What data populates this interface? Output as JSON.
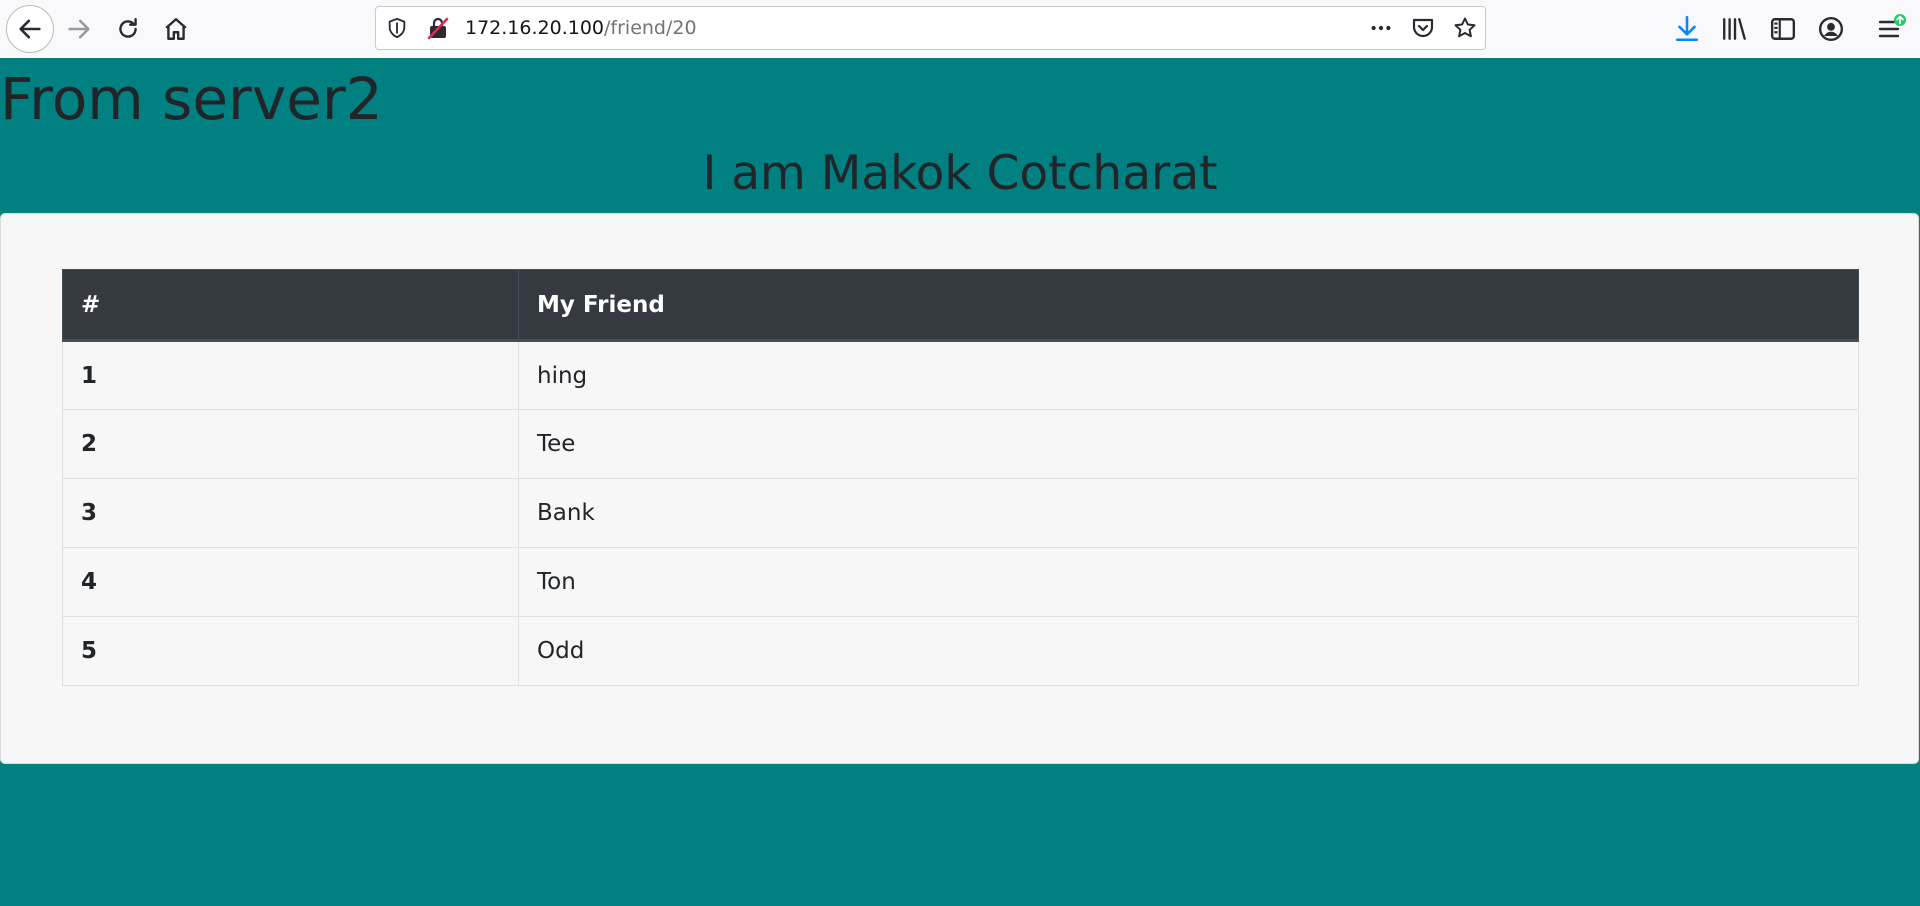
{
  "browser": {
    "url_host": "172.16.20.100",
    "url_path": "/friend/20",
    "icons": {
      "back": "back-arrow-icon",
      "forward": "forward-arrow-icon",
      "reload": "reload-icon",
      "home": "home-icon",
      "tracking": "shield-icon",
      "connection": "insecure-lock-icon",
      "page_actions": "more-icon",
      "pocket": "pocket-icon",
      "bookmark": "star-icon",
      "downloads": "download-icon",
      "library": "library-icon",
      "sidebar": "sidebar-icon",
      "account": "account-icon",
      "menu": "hamburger-menu-icon"
    },
    "accent_color": "#0a84ff",
    "update_badge_color": "#2ac769"
  },
  "page": {
    "background_color": "#008080",
    "server_heading": "From server2",
    "name_heading": "I am Makok Cotcharat",
    "table": {
      "headers": [
        "#",
        "My Friend"
      ],
      "rows": [
        {
          "num": "1",
          "name": "hing"
        },
        {
          "num": "2",
          "name": "Tee"
        },
        {
          "num": "3",
          "name": "Bank"
        },
        {
          "num": "4",
          "name": "Ton"
        },
        {
          "num": "5",
          "name": "Odd"
        }
      ]
    }
  }
}
